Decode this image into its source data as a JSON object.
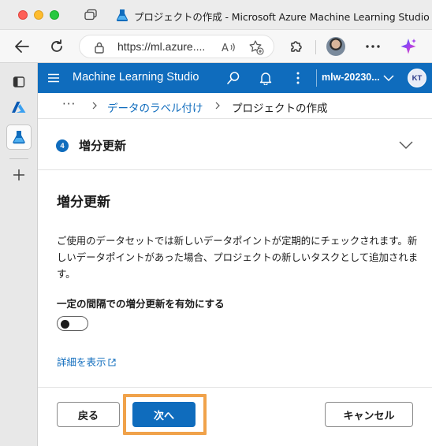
{
  "window": {
    "title": "プロジェクトの作成 - Microsoft Azure Machine Learning Studio"
  },
  "browser": {
    "url": "https://ml.azure....",
    "icons": [
      "tab-actions-icon",
      "back-arrow-icon",
      "reload-icon",
      "lock-icon",
      "read-aloud-icon",
      "add-favorite-icon",
      "extensions-icon",
      "profile-avatar",
      "more-icon",
      "copilot-icon"
    ]
  },
  "sidebar": {
    "icons": [
      "tabs-icon",
      "azure-icon",
      "machine-learning-icon",
      "add-icon"
    ]
  },
  "app_header": {
    "title": "Machine Learning Studio",
    "workspace": "mlw-20230...",
    "user_initials": "KT",
    "accent_color": "#0f6cbd"
  },
  "breadcrumb": {
    "ellipsis": "···",
    "link": "データのラベル付け",
    "current": "プロジェクトの作成"
  },
  "step": {
    "number": "4",
    "title": "増分更新"
  },
  "content": {
    "heading": "増分更新",
    "description": "ご使用のデータセットでは新しいデータポイントが定期的にチェックされます。新しいデータポイントがあった場合、プロジェクトの新しいタスクとして追加されます。",
    "toggle_label": "一定の間隔での増分更新を有効にする",
    "toggle_on": false,
    "details_link": "詳細を表示"
  },
  "footer": {
    "back_label": "戻る",
    "next_label": "次へ",
    "cancel_label": "キャンセル",
    "highlight_color": "#f0a24a"
  }
}
